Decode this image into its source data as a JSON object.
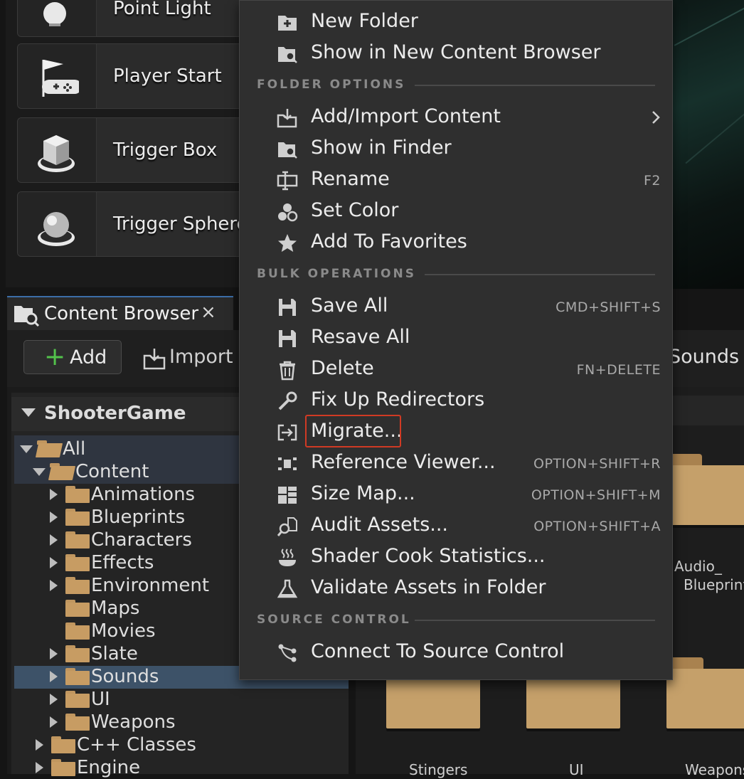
{
  "place_actors": {
    "items": [
      {
        "label": "Point Light",
        "icon": "light-bulb-icon"
      },
      {
        "label": "Player Start",
        "icon": "player-start-flag-icon"
      },
      {
        "label": "Trigger Box",
        "icon": "trigger-box-icon"
      },
      {
        "label": "Trigger Sphere",
        "icon": "trigger-sphere-icon"
      }
    ]
  },
  "content_browser": {
    "tab_title": "Content Browser",
    "close_glyph": "×",
    "add_label": "Add",
    "import_label": "Import",
    "breadcrumb_tail": "Sounds",
    "root_label": "ShooterGame",
    "tree": {
      "all": "All",
      "content": "Content",
      "folders": [
        "Animations",
        "Blueprints",
        "Characters",
        "Effects",
        "Environment",
        "Maps",
        "Movies",
        "Slate",
        "Sounds",
        "UI",
        "Weapons"
      ],
      "cpp": "C++ Classes",
      "engine": "Engine"
    },
    "grid_labels": {
      "audio_blueprints_line1": "Audio_",
      "audio_blueprints_line2": "Blueprints",
      "stingers": "Stingers",
      "ui": "UI",
      "weapons": "Weapons"
    }
  },
  "context_menu": {
    "top_items": [
      {
        "label": "New Folder",
        "icon": "new-folder-icon"
      },
      {
        "label": "Show in New Content Browser",
        "icon": "content-browser-search-icon"
      }
    ],
    "sections": {
      "folder_options": "FOLDER OPTIONS",
      "bulk_operations": "BULK OPERATIONS",
      "source_control": "SOURCE CONTROL"
    },
    "folder_options": [
      {
        "label": "Add/Import Content",
        "icon": "import-icon",
        "shortcut": ""
      },
      {
        "label": "Show in Finder",
        "icon": "finder-icon",
        "shortcut": ""
      },
      {
        "label": "Rename",
        "icon": "rename-icon",
        "shortcut": "F2"
      },
      {
        "label": "Set Color",
        "icon": "color-icon",
        "shortcut": ""
      },
      {
        "label": "Add To Favorites",
        "icon": "star-icon",
        "shortcut": ""
      }
    ],
    "bulk_operations": [
      {
        "label": "Save All",
        "icon": "save-icon",
        "shortcut": "CMD+SHIFT+S"
      },
      {
        "label": "Resave All",
        "icon": "save-icon",
        "shortcut": ""
      },
      {
        "label": "Delete",
        "icon": "trash-icon",
        "shortcut": "FN+DELETE"
      },
      {
        "label": "Fix Up Redirectors",
        "icon": "wrench-icon",
        "shortcut": ""
      },
      {
        "label": "Migrate...",
        "icon": "migrate-icon",
        "shortcut": ""
      },
      {
        "label": "Reference Viewer...",
        "icon": "reference-viewer-icon",
        "shortcut": "OPTION+SHIFT+R"
      },
      {
        "label": "Size Map...",
        "icon": "size-map-icon",
        "shortcut": "OPTION+SHIFT+M"
      },
      {
        "label": "Audit Assets...",
        "icon": "audit-icon",
        "shortcut": "OPTION+SHIFT+A"
      },
      {
        "label": "Shader Cook Statistics...",
        "icon": "shader-cook-icon",
        "shortcut": ""
      },
      {
        "label": "Validate Assets in Folder",
        "icon": "flask-icon",
        "shortcut": ""
      }
    ],
    "source_control": [
      {
        "label": "Connect To Source Control",
        "icon": "source-control-icon",
        "shortcut": ""
      }
    ]
  },
  "colors": {
    "menu_bg": "#2f2f2f",
    "selection": "#3d5268",
    "folder": "#c79c63",
    "highlight_box": "#d03a24",
    "add_plus": "#53c24b"
  }
}
